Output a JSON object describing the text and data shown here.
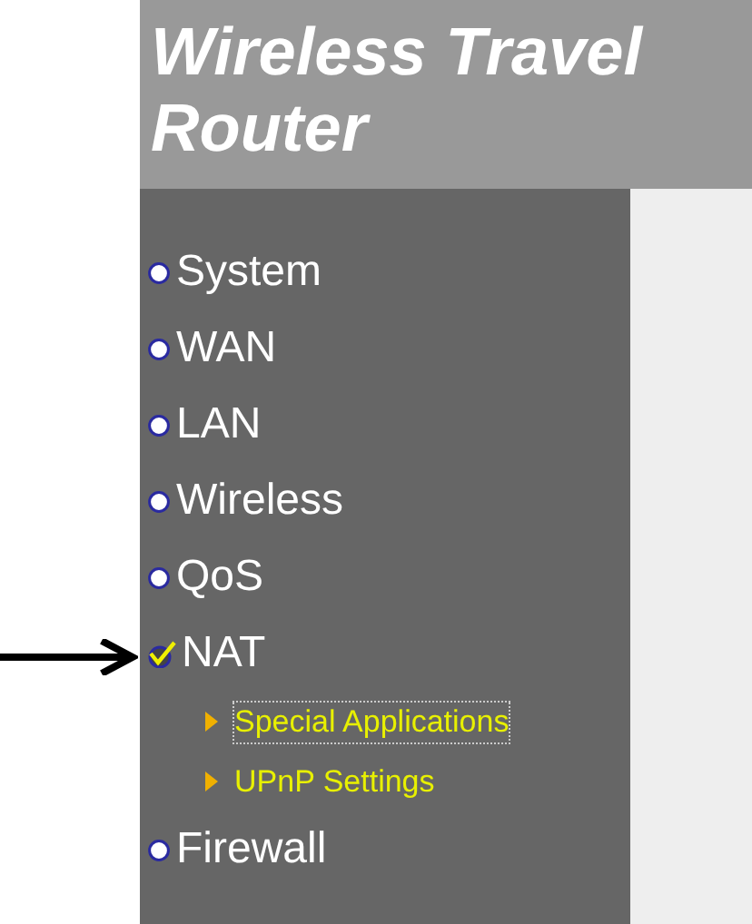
{
  "header": {
    "title": "Wireless Travel Router"
  },
  "menu": [
    {
      "label": "System",
      "selected": false
    },
    {
      "label": "WAN",
      "selected": false
    },
    {
      "label": "LAN",
      "selected": false
    },
    {
      "label": "Wireless",
      "selected": false
    },
    {
      "label": "QoS",
      "selected": false
    },
    {
      "label": "NAT",
      "selected": true,
      "children": [
        {
          "label": "Special Applications",
          "selected": true
        },
        {
          "label": "UPnP Settings",
          "selected": false
        }
      ]
    },
    {
      "label": "Firewall",
      "selected": false
    }
  ]
}
